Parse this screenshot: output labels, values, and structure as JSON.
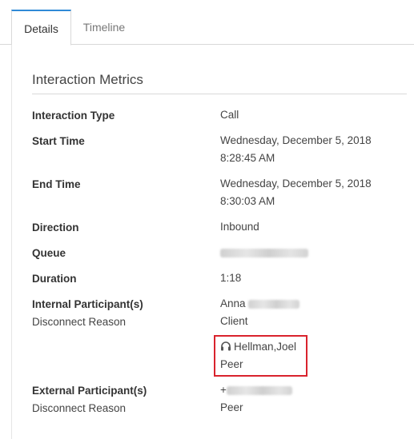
{
  "tabs": {
    "details": "Details",
    "timeline": "Timeline"
  },
  "section": {
    "title": "Interaction Metrics"
  },
  "metrics": {
    "interaction_type": {
      "label": "Interaction Type",
      "value": "Call"
    },
    "start_time": {
      "label": "Start Time",
      "line1": "Wednesday, December 5, 2018",
      "line2": "8:28:45 AM"
    },
    "end_time": {
      "label": "End Time",
      "line1": "Wednesday, December 5, 2018",
      "line2": "8:30:03 AM"
    },
    "direction": {
      "label": "Direction",
      "value": "Inbound"
    },
    "queue": {
      "label": "Queue",
      "value": ""
    },
    "duration": {
      "label": "Duration",
      "value": "1:18"
    },
    "internal": {
      "label": "Internal Participant(s)",
      "disconnect_label": "Disconnect Reason",
      "participant_1_name": "Anna",
      "participant_1_reason": "Client",
      "participant_2_name": "Hellman,Joel",
      "participant_2_reason": "Peer",
      "participant_2_icon": "headset-icon"
    },
    "external": {
      "label": "External Participant(s)",
      "disconnect_label": "Disconnect Reason",
      "participant_prefix": "+",
      "participant_reason": "Peer"
    }
  },
  "colors": {
    "tab_accent": "#2f8ad7",
    "highlight": "#d9232d"
  }
}
